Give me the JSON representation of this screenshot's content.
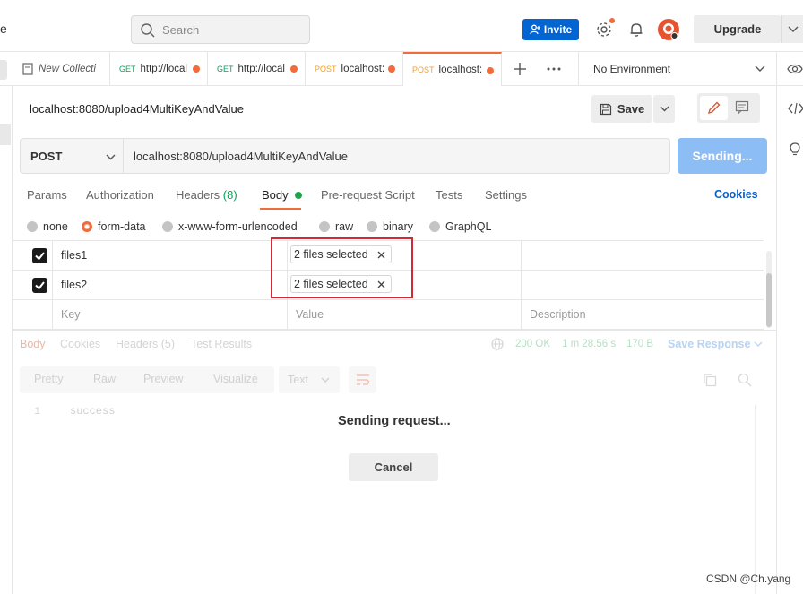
{
  "topbar": {
    "cut_text": "e",
    "search_placeholder": "Search",
    "invite_label": "Invite",
    "upgrade_label": "Upgrade"
  },
  "tabs": [
    {
      "method": "",
      "label": "New Collecti"
    },
    {
      "method": "GET",
      "label": "http://local"
    },
    {
      "method": "GET",
      "label": "http://local"
    },
    {
      "method": "POST",
      "label": "localhost:"
    },
    {
      "method": "POST",
      "label": "localhost:"
    }
  ],
  "environment": {
    "label": "No Environment"
  },
  "request": {
    "title": "localhost:8080/upload4MultiKeyAndValue",
    "save_label": "Save",
    "method": "POST",
    "url": "localhost:8080/upload4MultiKeyAndValue",
    "send_label": "Sending..."
  },
  "request_tabs": {
    "params": "Params",
    "authorization": "Authorization",
    "headers": "Headers",
    "headers_count": "(8)",
    "body": "Body",
    "prerequest": "Pre-request Script",
    "tests": "Tests",
    "settings": "Settings",
    "cookies": "Cookies"
  },
  "body_types": {
    "none": "none",
    "form_data": "form-data",
    "urlencoded": "x-www-form-urlencoded",
    "raw": "raw",
    "binary": "binary",
    "graphql": "GraphQL"
  },
  "form_rows": [
    {
      "key": "files1",
      "value": "2 files selected"
    },
    {
      "key": "files2",
      "value": "2 files selected"
    }
  ],
  "form_placeholders": {
    "key": "Key",
    "value": "Value",
    "description": "Description"
  },
  "response": {
    "tabs": {
      "body": "Body",
      "cookies": "Cookies",
      "headers": "Headers (5)",
      "tests": "Test Results"
    },
    "status": "200 OK",
    "time": "1 m 28.56 s",
    "size": "170 B",
    "save_response": "Save Response",
    "view_modes": {
      "pretty": "Pretty",
      "raw": "Raw",
      "preview": "Preview",
      "visualize": "Visualize",
      "format": "Text"
    },
    "line_number": "1",
    "content": "success"
  },
  "overlay": {
    "sending_text": "Sending request...",
    "cancel_label": "Cancel"
  },
  "watermark": "CSDN @Ch.yang"
}
